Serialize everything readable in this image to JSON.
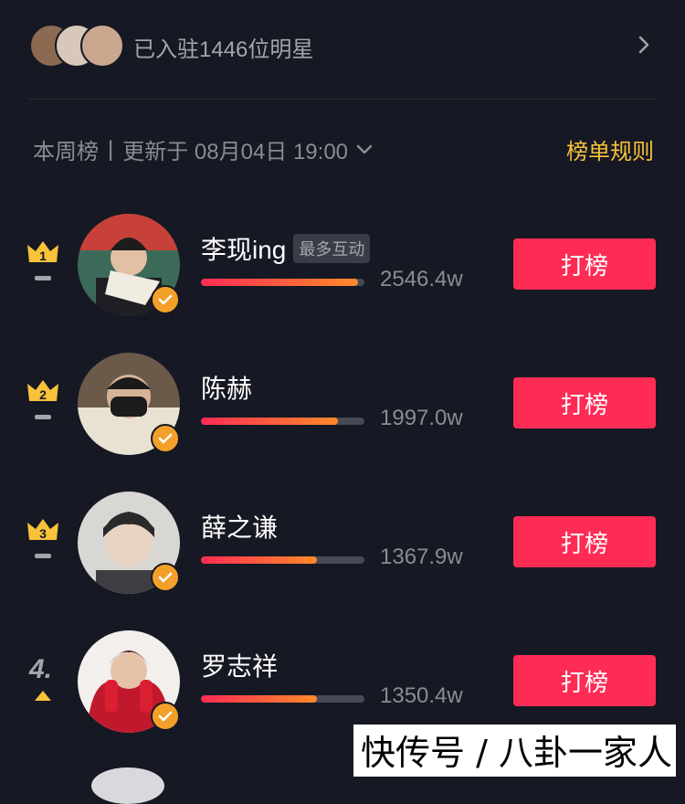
{
  "header": {
    "count_text": "已入驻1446位明星"
  },
  "filter": {
    "tab": "本周榜",
    "separator": "|",
    "update_text": "更新于 08月04日 19:00",
    "rules_label": "榜单规则"
  },
  "ranking": [
    {
      "rank": "1",
      "name": "李现ing",
      "tag": "最多互动",
      "score": "2546.4w",
      "progress": 0.96,
      "vote_label": "打榜",
      "avatar_color": "#3b6b58"
    },
    {
      "rank": "2",
      "name": "陈赫",
      "tag": "",
      "score": "1997.0w",
      "progress": 0.84,
      "vote_label": "打榜",
      "avatar_color": "#6b5a4a"
    },
    {
      "rank": "3",
      "name": "薛之谦",
      "tag": "",
      "score": "1367.9w",
      "progress": 0.71,
      "vote_label": "打榜",
      "avatar_color": "#5a5a5e"
    },
    {
      "rank": "4.",
      "name": "罗志祥",
      "tag": "",
      "score": "1350.4w",
      "progress": 0.71,
      "vote_label": "打榜",
      "avatar_color": "#c0192b"
    }
  ],
  "colors": {
    "accent": "#fe2c55",
    "gold": "#f8c23a",
    "background": "#161823"
  },
  "watermark": "快传号 / 八卦一家人"
}
